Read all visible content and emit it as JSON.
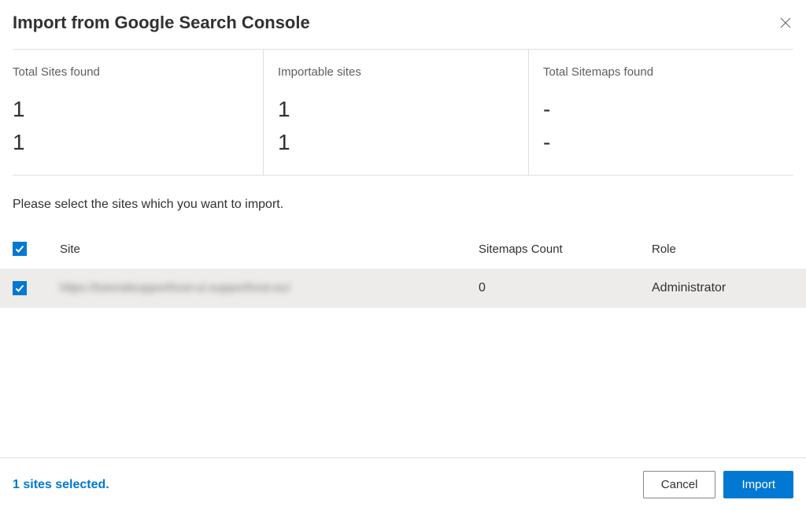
{
  "dialog": {
    "title": "Import from Google Search Console"
  },
  "stats": {
    "total_sites": {
      "label": "Total Sites found",
      "value1": "1",
      "value2": "1"
    },
    "importable": {
      "label": "Importable sites",
      "value1": "1",
      "value2": "1"
    },
    "sitemaps": {
      "label": "Total Sitemaps found",
      "value1": "-",
      "value2": "-"
    }
  },
  "instruction": "Please select the sites which you want to import.",
  "table": {
    "headers": {
      "site": "Site",
      "sitemaps": "Sitemaps Count",
      "role": "Role"
    },
    "rows": [
      {
        "site": "https://tutorialsupporthost-ui.supporthost.eu/",
        "sitemaps": "0",
        "role": "Administrator"
      }
    ]
  },
  "footer": {
    "selected": "1 sites selected.",
    "cancel": "Cancel",
    "import": "Import"
  }
}
